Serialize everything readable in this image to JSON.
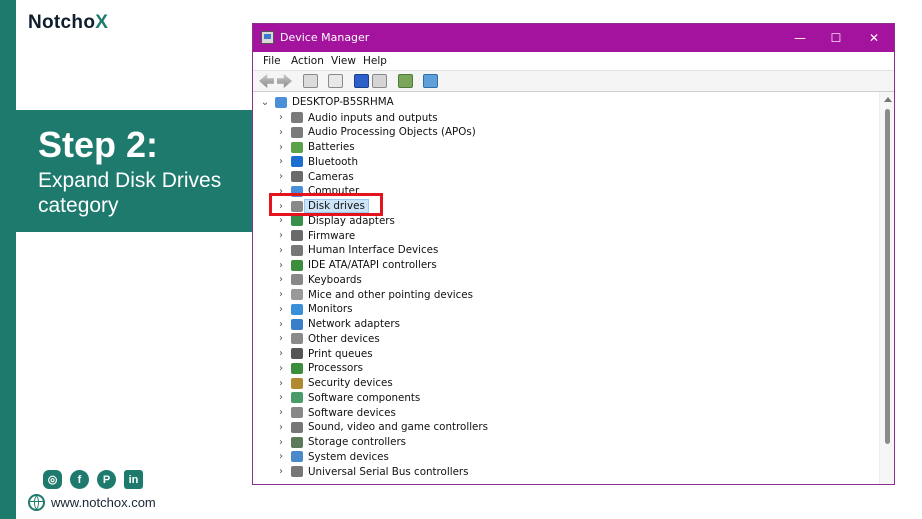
{
  "brand": {
    "name_main": "Notcho",
    "name_accent": "X"
  },
  "step": {
    "title": "Step 2:",
    "subtitle": "Expand Disk Drives category"
  },
  "social": [
    {
      "icon": "instagram-icon",
      "glyph": "◎"
    },
    {
      "icon": "facebook-icon",
      "glyph": "f"
    },
    {
      "icon": "pinterest-icon",
      "glyph": "P"
    },
    {
      "icon": "linkedin-icon",
      "glyph": "in"
    }
  ],
  "website": "www.notchox.com",
  "window": {
    "title": "Device Manager",
    "controls": {
      "minimize": "—",
      "maximize": "☐",
      "close": "✕"
    },
    "menu": [
      "File",
      "Action",
      "View",
      "Help"
    ],
    "root": {
      "chevron": "⌄",
      "label": "DESKTOP-B5SRHMA"
    },
    "categories": [
      {
        "label": "Audio inputs and outputs",
        "color": "#7a7a7a"
      },
      {
        "label": "Audio Processing Objects (APOs)",
        "color": "#7a7a7a"
      },
      {
        "label": "Batteries",
        "color": "#5aa24a"
      },
      {
        "label": "Bluetooth",
        "color": "#1c6fd1"
      },
      {
        "label": "Cameras",
        "color": "#6b6b6b"
      },
      {
        "label": "Computer",
        "color": "#4a90d9"
      },
      {
        "label": "Disk drives",
        "color": "#8a8a8a"
      },
      {
        "label": "Display adapters",
        "color": "#3a8f4a"
      },
      {
        "label": "Firmware",
        "color": "#6a6a6a"
      },
      {
        "label": "Human Interface Devices",
        "color": "#777777"
      },
      {
        "label": "IDE ATA/ATAPI controllers",
        "color": "#3c8d3c"
      },
      {
        "label": "Keyboards",
        "color": "#888888"
      },
      {
        "label": "Mice and other pointing devices",
        "color": "#999999"
      },
      {
        "label": "Monitors",
        "color": "#3a8fd9"
      },
      {
        "label": "Network adapters",
        "color": "#3a7fc9"
      },
      {
        "label": "Other devices",
        "color": "#8a8a8a"
      },
      {
        "label": "Print queues",
        "color": "#555555"
      },
      {
        "label": "Processors",
        "color": "#3c8d3c"
      },
      {
        "label": "Security devices",
        "color": "#b08a30"
      },
      {
        "label": "Software components",
        "color": "#4a9a6a"
      },
      {
        "label": "Software devices",
        "color": "#888888"
      },
      {
        "label": "Sound, video and game controllers",
        "color": "#777777"
      },
      {
        "label": "Storage controllers",
        "color": "#5a7a5a"
      },
      {
        "label": "System devices",
        "color": "#4a8ac9"
      },
      {
        "label": "Universal Serial Bus controllers",
        "color": "#777777"
      }
    ],
    "chevron": "›"
  },
  "colors": {
    "accent": "#1e7a6c",
    "titlebar": "#a3139e",
    "highlight": "#e5141c",
    "selection": "#cce4f7"
  }
}
